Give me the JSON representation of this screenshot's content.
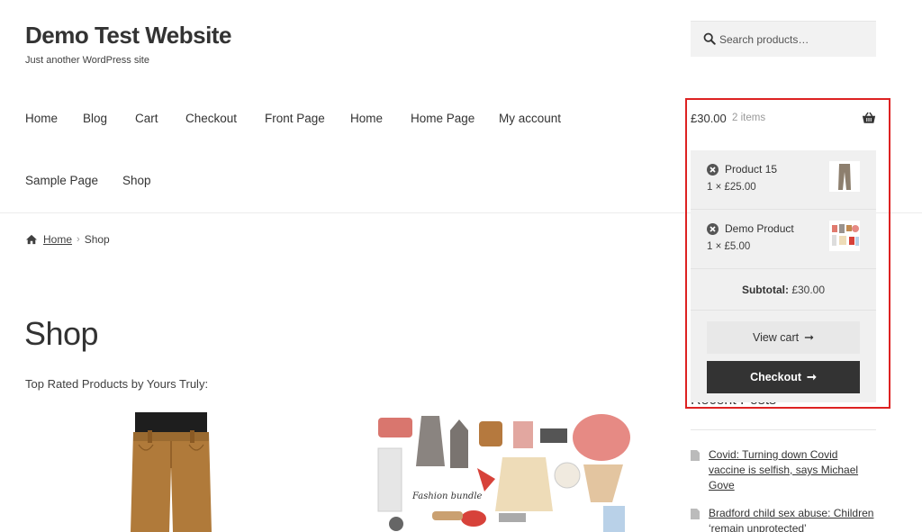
{
  "site": {
    "title": "Demo Test Website",
    "description": "Just another WordPress site"
  },
  "search": {
    "placeholder": "Search products…"
  },
  "nav": {
    "items": [
      "Home",
      "Blog",
      "Cart",
      "Checkout",
      "Front Page",
      "Home",
      "Home Page",
      "My account",
      "Sample Page",
      "Shop"
    ]
  },
  "breadcrumb": {
    "home": "Home",
    "separator": "›",
    "current": "Shop"
  },
  "page": {
    "title": "Shop",
    "section_label": "Top Rated Products by Yours Truly:"
  },
  "cart": {
    "amount": "£30.00",
    "count": "2 items",
    "items": [
      {
        "name": "Product 15",
        "qty": "1 × £25.00"
      },
      {
        "name": "Demo Product",
        "qty": "1 × £5.00"
      }
    ],
    "subtotal_label": "Subtotal:",
    "subtotal_value": "£30.00",
    "view_cart": "View cart",
    "checkout": "Checkout"
  },
  "sidebar": {
    "recent_title": "Recent Posts",
    "posts": [
      "Covid: Turning down Covid vaccine is selfish, says Michael Gove",
      "Bradford child sex abuse: Children ‘remain unprotected’"
    ]
  },
  "colors": {
    "highlight": "#dd2222",
    "button_dark": "#333333"
  }
}
